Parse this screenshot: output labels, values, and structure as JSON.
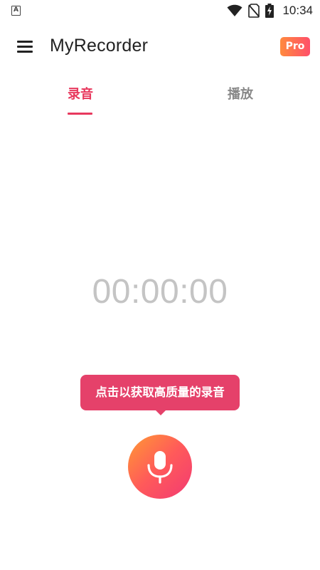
{
  "status_bar": {
    "left_icon": "A",
    "icons": [
      "wifi-icon",
      "no-sim-icon",
      "battery-charging-icon"
    ],
    "time": "10:34"
  },
  "app_bar": {
    "menu_icon": "hamburger-menu-icon",
    "title": "MyRecorder",
    "pro_badge": "Pro"
  },
  "tabs": [
    {
      "label": "录音",
      "active": true
    },
    {
      "label": "播放",
      "active": false
    }
  ],
  "timer": "00:00:00",
  "tooltip": "点击以获取高质量的录音",
  "record_button": {
    "icon": "microphone-icon"
  },
  "colors": {
    "accent": "#e8395e",
    "tooltip_bg": "#e5416a",
    "record_gradient_start": "#ff9a33",
    "record_gradient_end": "#f23a73",
    "timer_text": "#c4c4c4"
  }
}
